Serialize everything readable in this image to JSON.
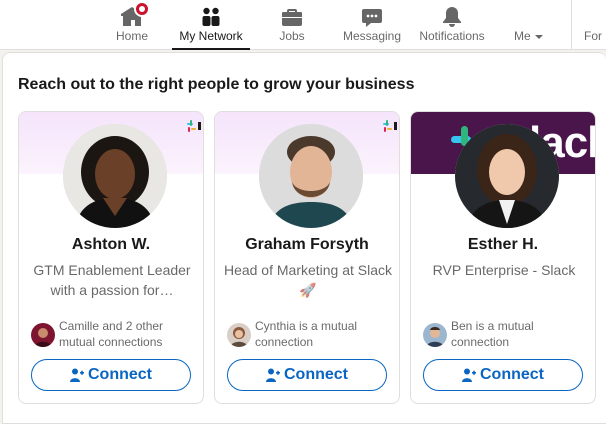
{
  "nav": {
    "items": [
      {
        "label": "Home",
        "icon": "home-icon"
      },
      {
        "label": "My Network",
        "icon": "network-icon"
      },
      {
        "label": "Jobs",
        "icon": "briefcase-icon"
      },
      {
        "label": "Messaging",
        "icon": "chat-icon"
      },
      {
        "label": "Notifications",
        "icon": "bell-icon"
      },
      {
        "label": "Me",
        "icon": "caret-down-icon"
      },
      {
        "label": "For"
      }
    ],
    "active": "My Network",
    "accent": "#0a66c2",
    "badge_color": "#cb112d"
  },
  "section": {
    "heading": "Reach out to the right people to grow your business"
  },
  "cards": [
    {
      "name": "Ashton W.",
      "title": "GTM Enablement Leader with a passion for…",
      "mutual": "Camille and 2 other mutual connections",
      "button": "Connect"
    },
    {
      "name": "Graham Forsyth",
      "title": "Head of Marketing at Slack 🚀",
      "mutual": "Cynthia is a mutual connection",
      "button": "Connect"
    },
    {
      "name": "Esther H.",
      "title": "RVP Enterprise - Slack",
      "mutual": "Ben is a mutual connection",
      "button": "Connect",
      "banner_text": "lack"
    }
  ]
}
